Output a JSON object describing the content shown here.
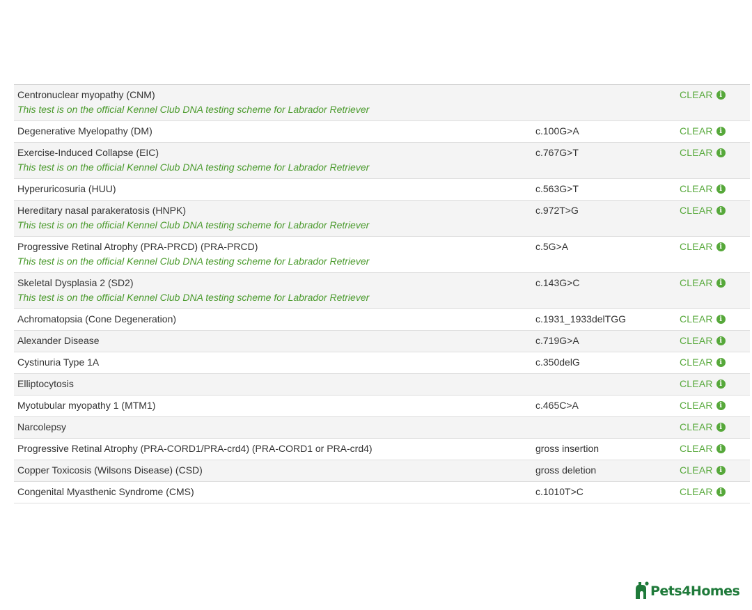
{
  "results": [
    {
      "test": "Centronuclear myopathy (CNM)",
      "note": "This test is on the official Kennel Club DNA testing scheme for Labrador Retriever",
      "variant": "",
      "result": "CLEAR"
    },
    {
      "test": "Degenerative Myelopathy (DM)",
      "note": "",
      "variant": "c.100G>A",
      "result": "CLEAR"
    },
    {
      "test": "Exercise-Induced Collapse (EIC)",
      "note": "This test is on the official Kennel Club DNA testing scheme for Labrador Retriever",
      "variant": "c.767G>T",
      "result": "CLEAR"
    },
    {
      "test": "Hyperuricosuria (HUU)",
      "note": "",
      "variant": "c.563G>T",
      "result": "CLEAR"
    },
    {
      "test": "Hereditary nasal parakeratosis (HNPK)",
      "note": "This test is on the official Kennel Club DNA testing scheme for Labrador Retriever",
      "variant": "c.972T>G",
      "result": "CLEAR"
    },
    {
      "test": "Progressive Retinal Atrophy (PRA-PRCD) (PRA-PRCD)",
      "note": "This test is on the official Kennel Club DNA testing scheme for Labrador Retriever",
      "variant": "c.5G>A",
      "result": "CLEAR"
    },
    {
      "test": "Skeletal Dysplasia 2 (SD2)",
      "note": "This test is on the official Kennel Club DNA testing scheme for Labrador Retriever",
      "variant": "c.143G>C",
      "result": "CLEAR"
    },
    {
      "test": "Achromatopsia (Cone Degeneration)",
      "note": "",
      "variant": "c.1931_1933delTGG",
      "result": "CLEAR"
    },
    {
      "test": "Alexander Disease",
      "note": "",
      "variant": "c.719G>A",
      "result": "CLEAR"
    },
    {
      "test": "Cystinuria Type 1A",
      "note": "",
      "variant": "c.350delG",
      "result": "CLEAR"
    },
    {
      "test": "Elliptocytosis",
      "note": "",
      "variant": "",
      "result": "CLEAR"
    },
    {
      "test": "Myotubular myopathy 1 (MTM1)",
      "note": "",
      "variant": "c.465C>A",
      "result": "CLEAR"
    },
    {
      "test": "Narcolepsy",
      "note": "",
      "variant": "",
      "result": "CLEAR"
    },
    {
      "test": "Progressive Retinal Atrophy (PRA-CORD1/PRA-crd4) (PRA-CORD1 or PRA-crd4)",
      "note": "",
      "variant": "gross insertion",
      "result": "CLEAR"
    },
    {
      "test": "Copper Toxicosis (Wilsons Disease) (CSD)",
      "note": "",
      "variant": "gross deletion",
      "result": "CLEAR"
    },
    {
      "test": "Congenital Myasthenic Syndrome (CMS)",
      "note": "",
      "variant": "c.1010T>C",
      "result": "CLEAR"
    }
  ],
  "info_icon_glyph": "i",
  "info_icon_name": "info-icon",
  "brand": {
    "name": "Pets4Homes",
    "icon": "pets4homes-logo-icon",
    "color": "#1f7a3a"
  },
  "colors": {
    "result_clear": "#56a83a",
    "note": "#4a9a2c",
    "row_alt": "#f4f4f4"
  }
}
